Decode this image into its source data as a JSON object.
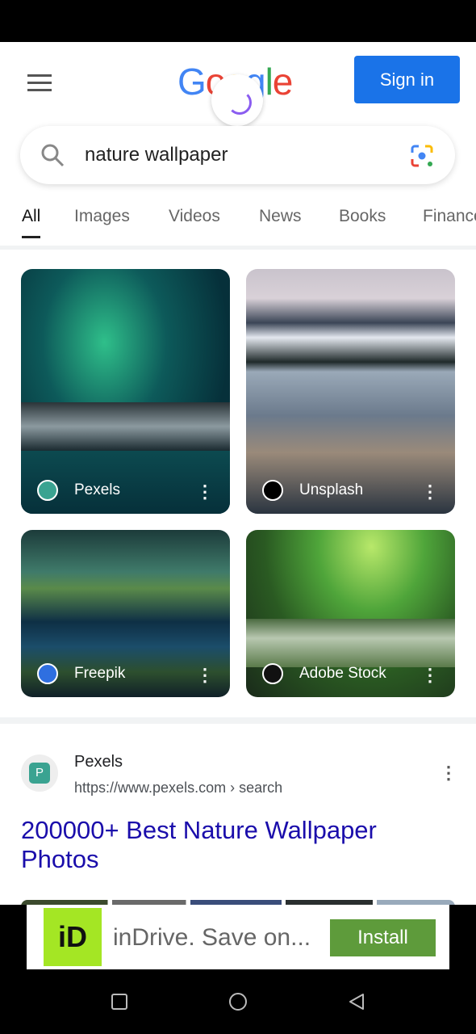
{
  "header": {
    "logo": "Google",
    "sign_in": "Sign in"
  },
  "search": {
    "query": "nature wallpaper",
    "icons": [
      "search-icon",
      "google-lens-icon"
    ]
  },
  "tabs": [
    "All",
    "Images",
    "Videos",
    "News",
    "Books",
    "Finance"
  ],
  "image_results": [
    {
      "source": "Pexels"
    },
    {
      "source": "Unsplash"
    },
    {
      "source": "Freepik"
    },
    {
      "source": "Adobe Stock"
    }
  ],
  "result": {
    "site": "Pexels",
    "url": "https://www.pexels.com › search",
    "title": "200000+ Best Nature Wallpaper Photos"
  },
  "ad": {
    "logo": "iD",
    "text": "inDrive. Save on...",
    "install": "Install"
  },
  "colors": {
    "accent": "#1a73e8",
    "link": "#1a0dab",
    "install": "#5e9b3b"
  }
}
